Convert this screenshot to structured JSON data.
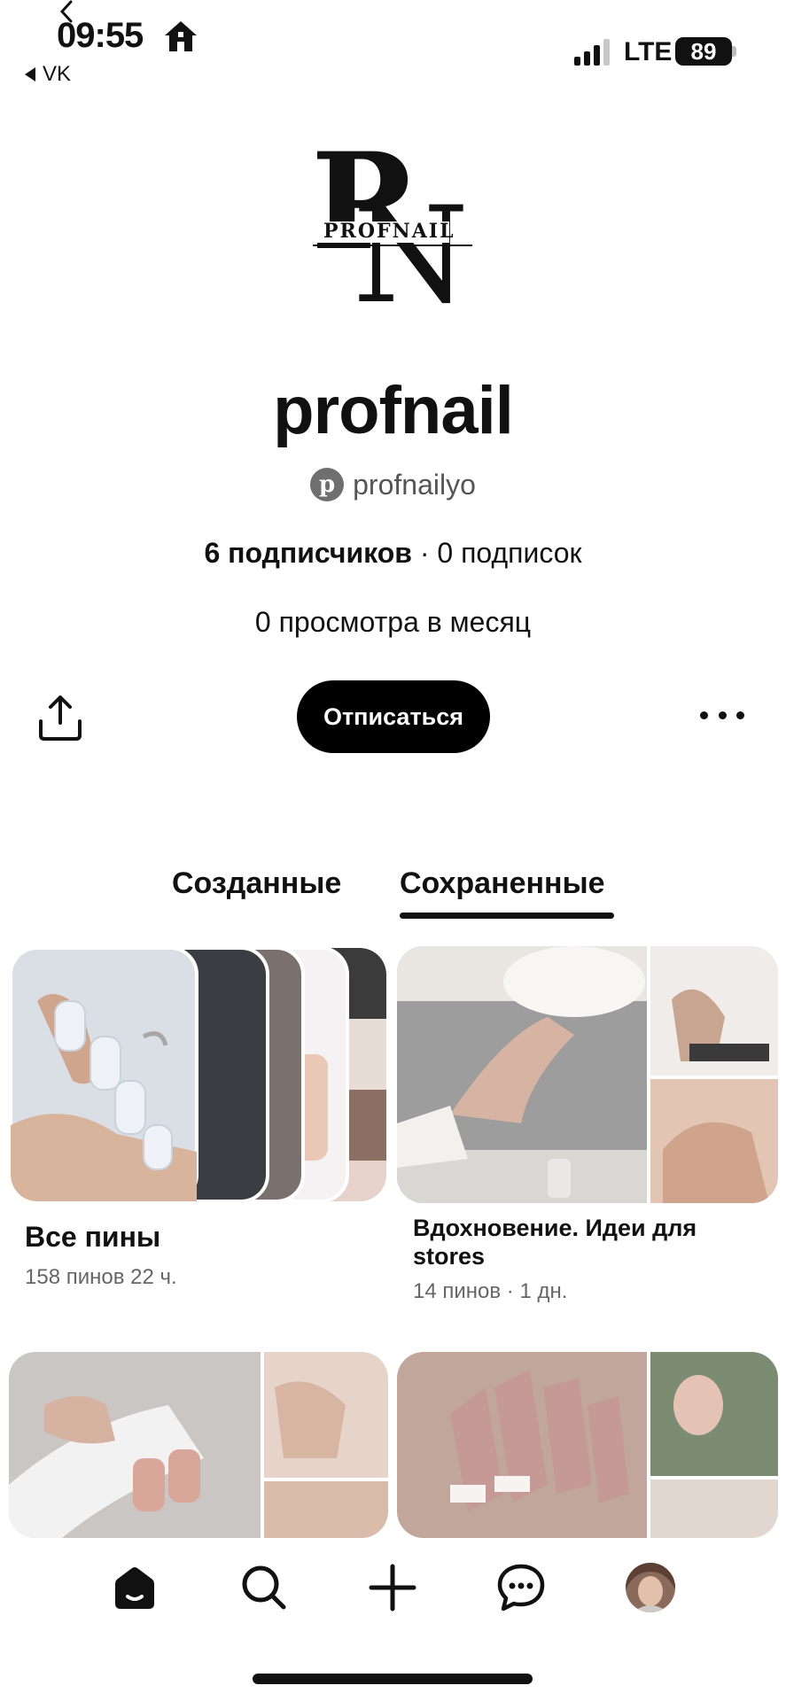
{
  "status_bar": {
    "time": "09:55",
    "back_app": "VK",
    "network": "LTE",
    "battery": "89"
  },
  "profile": {
    "logo_text": "PROFNAIL",
    "name": "profnail",
    "handle": "profnailyo",
    "followers": "6 подписчиков",
    "separator": " · ",
    "following": "0 подписок",
    "views": "0 просмотра в месяц",
    "unfollow_label": "Отписаться"
  },
  "tabs": [
    {
      "label": "Созданные",
      "active": false
    },
    {
      "label": "Сохраненные",
      "active": true
    }
  ],
  "boards": [
    {
      "title": "Все пины",
      "meta": "158 пинов   22 ч."
    },
    {
      "title": "Вдохновение. Идеи для stores",
      "meta": "14 пинов · 1 дн."
    }
  ],
  "icons": {
    "back": "chevron-left-icon",
    "home_status": "house-icon",
    "share": "share-icon",
    "more": "ellipsis-icon",
    "nav_home": "home-icon",
    "nav_search": "search-icon",
    "nav_create": "plus-icon",
    "nav_messages": "chat-icon",
    "nav_profile": "avatar"
  },
  "colors": {
    "button_bg": "#000000",
    "button_text": "#ffffff",
    "text": "#111111",
    "muted": "#666666"
  }
}
